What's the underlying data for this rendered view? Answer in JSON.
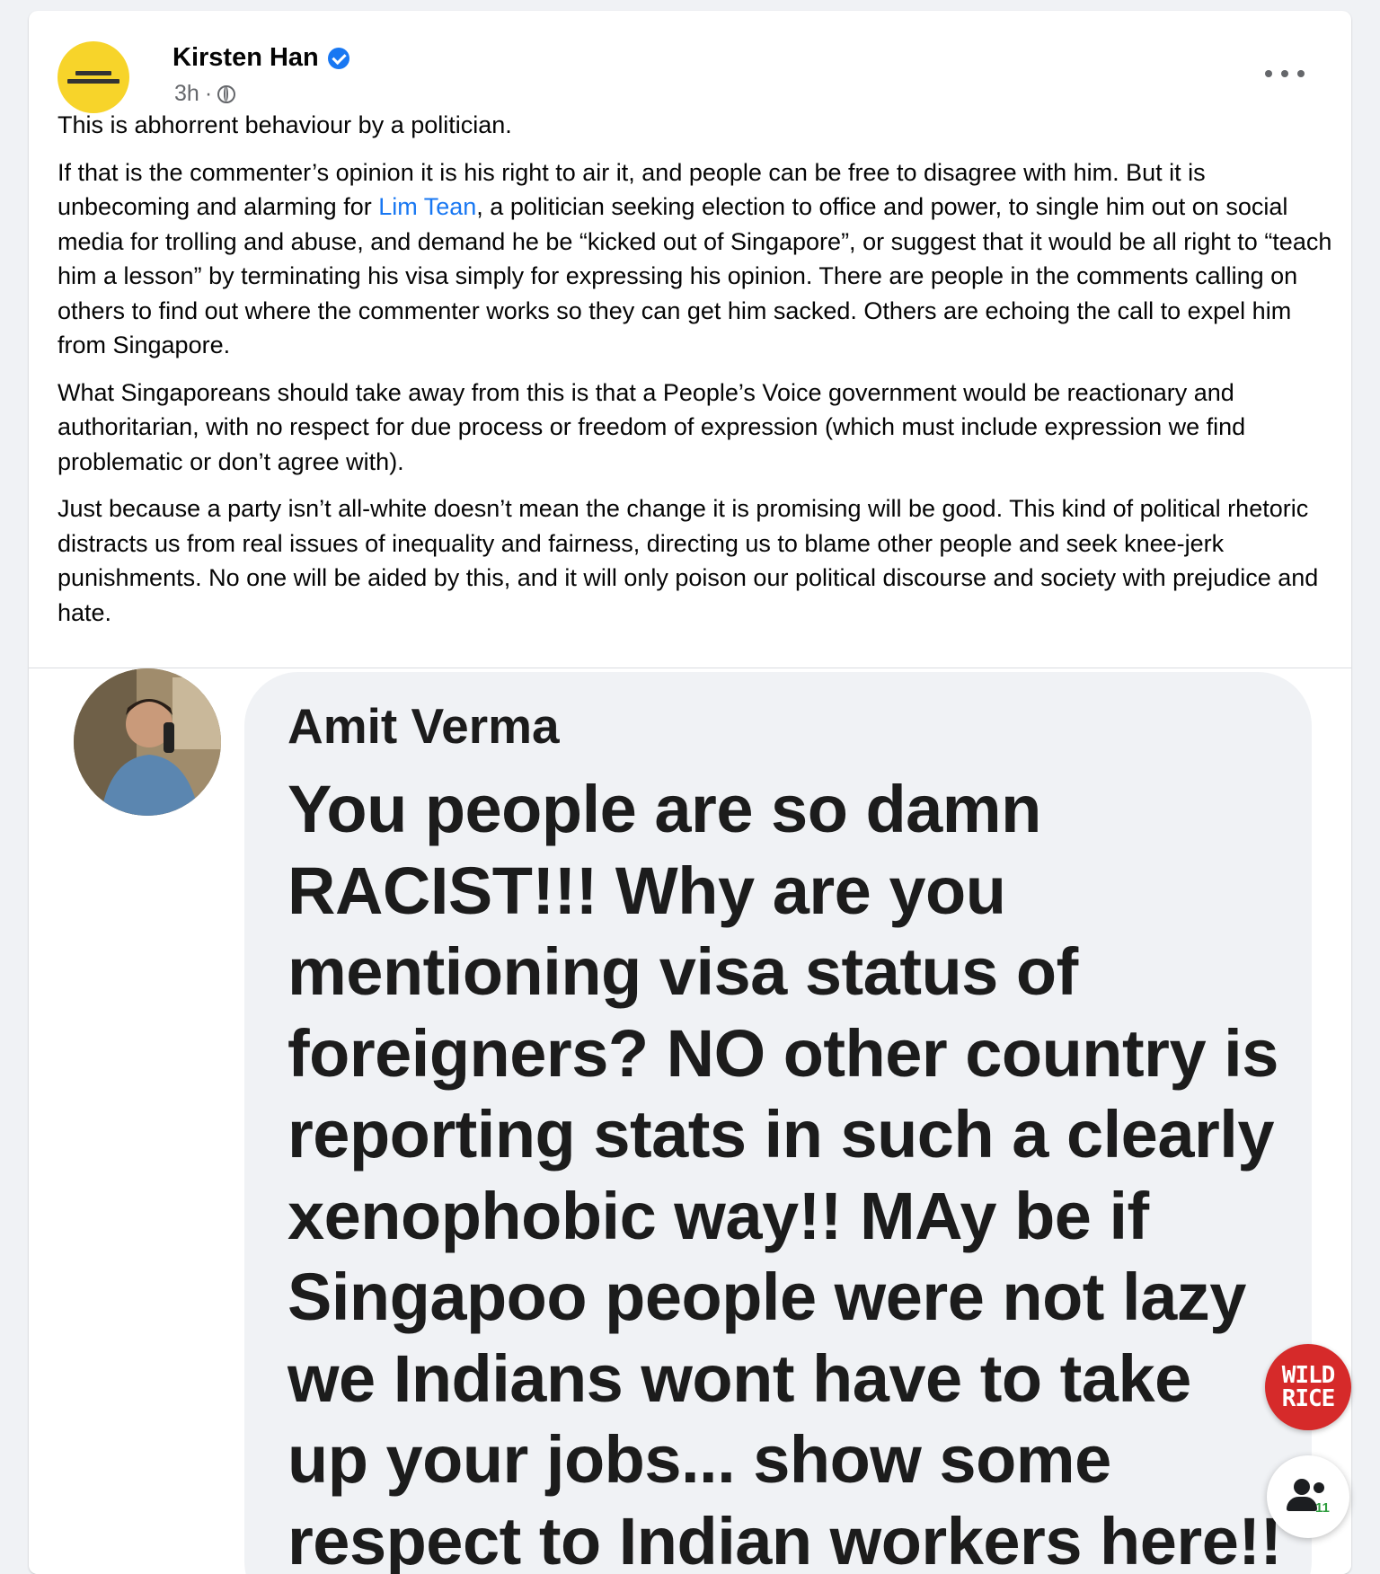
{
  "post": {
    "author": "Kirsten Han",
    "time": "3h",
    "separator": "·",
    "paragraphs": {
      "p1": "This is abhorrent behaviour by a politician.",
      "p2_before": "If that is the commenter’s opinion it is his right to air it, and people can be free to disagree with him. But it is unbecoming and alarming for ",
      "p2_mention": "Lim Tean",
      "p2_after": ", a politician seeking election to office and power, to single him out on social media for trolling and abuse, and demand he be “kicked out of Singapore”, or suggest that it would be all right to “teach him a lesson” by terminating his visa simply for expressing his opinion. There are people in the comments calling on others to find out where the commenter works so they can get him sacked. Others are echoing the call to expel him from Singapore.",
      "p3": "What Singaporeans should take away from this is that a People’s Voice government would be reactionary and authoritarian, with no respect for due process or freedom of expression (which must include expression we find problematic or don’t agree with).",
      "p4": "Just because a party isn’t all-white doesn’t mean the change it is promising will be good. This kind of political rhetoric distracts us from real issues of inequality and fairness, directing us to blame other people and seek knee-jerk punishments. No one will be aided by this, and it will only poison our political discourse and society with prejudice and hate."
    }
  },
  "screenshot_comment": {
    "author": "Amit Verma",
    "text": "You people are so damn RACIST!!! Why are you mentioning visa status of foreigners? NO other country is reporting stats in such a clearly xenophobic way!! MAy be if Singapoo people were not lazy we Indians wont have to take up your jobs... show some respect to Indian workers here!!"
  },
  "overlay": {
    "badge_line1": "WILD",
    "badge_line2": "RICE",
    "people_count": "11"
  },
  "icons": {
    "verified": "verified-badge-icon",
    "audience": "globe-icon",
    "more": "more-options-icon",
    "people": "people-icon"
  },
  "colors": {
    "link": "#1877f2",
    "verified": "#1877f2",
    "avatar_bg": "#f7d42a",
    "badge_bg": "#d62a2a",
    "people_count": "#2e9d3e"
  }
}
